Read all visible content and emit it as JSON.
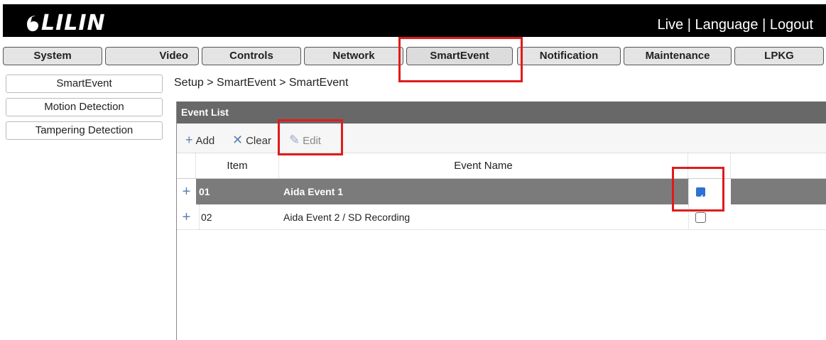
{
  "header": {
    "logo_text": "LILIN",
    "links": [
      "Live",
      "Language",
      "Logout"
    ],
    "separator": "|"
  },
  "nav": {
    "tabs": [
      {
        "label": "System"
      },
      {
        "label": "Video"
      },
      {
        "label": "Controls"
      },
      {
        "label": "Network"
      },
      {
        "label": "SmartEvent",
        "active": true
      },
      {
        "label": "Notification"
      },
      {
        "label": "Maintenance"
      },
      {
        "label": "LPKG"
      }
    ]
  },
  "sidebar": {
    "items": [
      {
        "label": "SmartEvent"
      },
      {
        "label": "Motion Detection"
      },
      {
        "label": "Tampering Detection"
      }
    ]
  },
  "breadcrumb": "Setup > SmartEvent > SmartEvent",
  "panel": {
    "title": "Event List",
    "toolbar": {
      "add_label": "Add",
      "clear_label": "Clear",
      "edit_label": "Edit"
    },
    "columns": {
      "item": "Item",
      "event_name": "Event Name"
    },
    "rows": [
      {
        "item": "01",
        "event_name": "Aida Event 1",
        "checked": true,
        "selected": true
      },
      {
        "item": "02",
        "event_name": "Aida Event 2 / SD Recording",
        "checked": false,
        "selected": false
      }
    ]
  },
  "colors": {
    "highlight_box": "#e01b1b",
    "header_bg": "#000000",
    "panel_head_bg": "#686868",
    "selected_row_bg": "#7b7b7b",
    "accent_icon": "#5a7fb4",
    "checkbox_checked": "#2d72d2"
  }
}
